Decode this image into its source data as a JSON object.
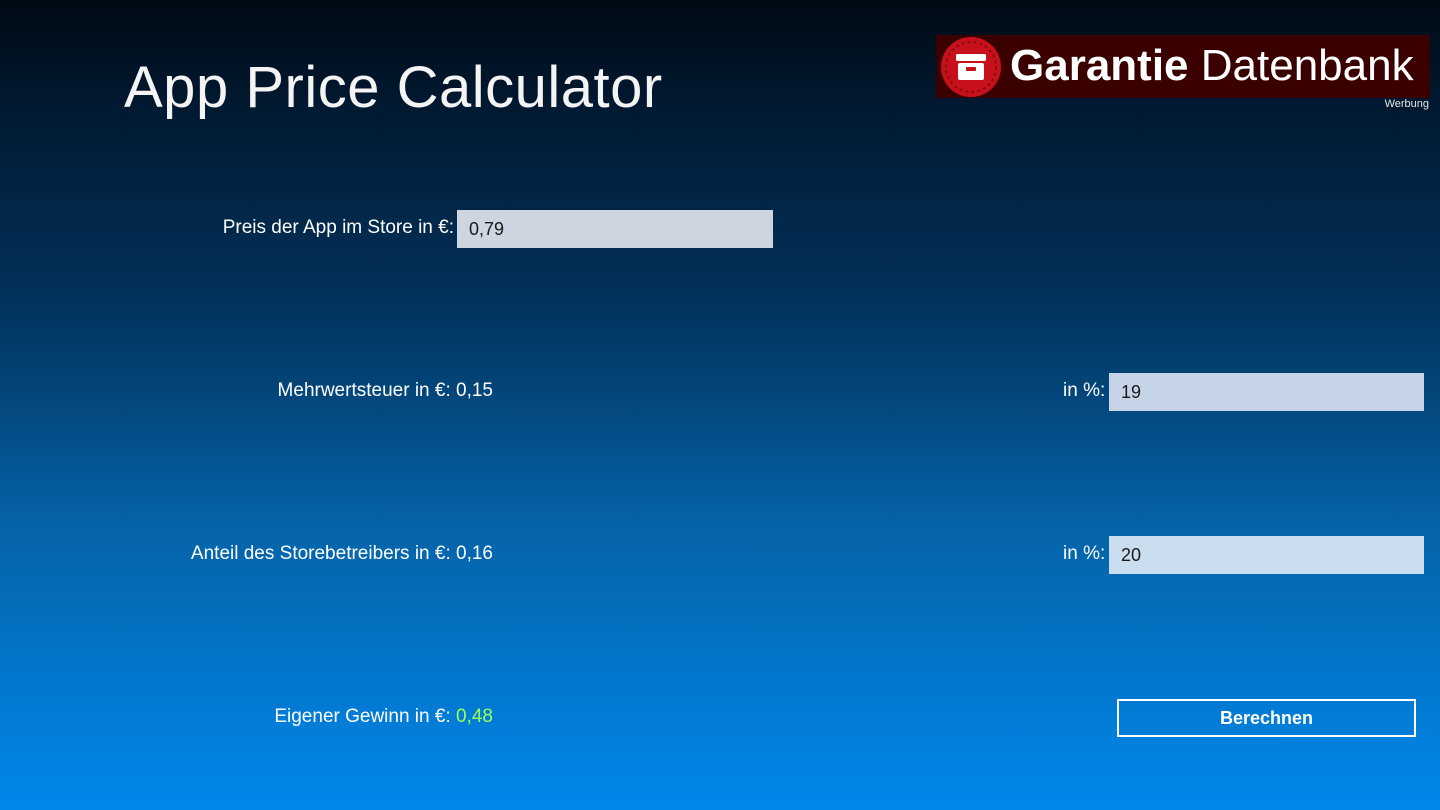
{
  "app": {
    "title": "App Price Calculator"
  },
  "ad": {
    "brand_bold": "Garantie",
    "brand_regular": "Datenbank",
    "label": "Werbung",
    "logo_icon": "box-icon",
    "colors": {
      "background": "#3a0000",
      "logo": "#c8101a"
    }
  },
  "price": {
    "label": "Preis der App im Store in €:",
    "value": "0,79"
  },
  "vat": {
    "label": "Mehrwertsteuer in €:",
    "value": "0,15",
    "percent_label": "in %:",
    "percent_value": "19"
  },
  "store_share": {
    "label": "Anteil des Storebetreibers in €:",
    "value": "0,16",
    "percent_label": "in %:",
    "percent_value": "20"
  },
  "profit": {
    "label": "Eigener Gewinn in €:",
    "value": "0,48",
    "color": "#9dff54"
  },
  "actions": {
    "calculate_label": "Berechnen"
  }
}
